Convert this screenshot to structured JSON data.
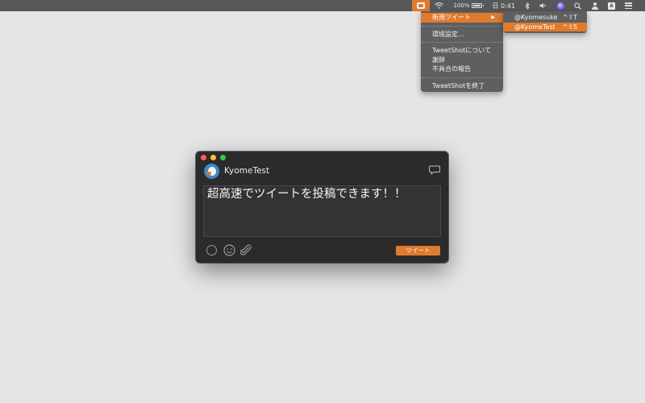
{
  "menubar": {
    "battery_percent": "100%",
    "clock": "日 0:41",
    "input_badge": "A",
    "status_icons": [
      "tweetshot-app-icon",
      "wifi-icon",
      "battery-icon",
      "bluetooth-icon",
      "volume-icon",
      "siri-icon",
      "search-icon",
      "user-icon",
      "input-source-icon",
      "notification-list-icon"
    ]
  },
  "menu": {
    "items": [
      {
        "label": "新規ツイート",
        "has_submenu": true,
        "highlighted": true
      },
      {
        "label": "環境設定..."
      },
      {
        "label": "TweetShotについて"
      },
      {
        "label": "謝辞"
      },
      {
        "label": "不具合の報告"
      },
      {
        "label": "TweetShotを終了"
      }
    ],
    "submenu": [
      {
        "label": "@Kyomesuke",
        "shortcut": "^⇧T"
      },
      {
        "label": "@KyomeTest",
        "shortcut": "^⇧S",
        "highlighted": true
      }
    ]
  },
  "window": {
    "username": "KyomeTest",
    "tweet_text": "超高速でツイートを投稿できます！！",
    "tweet_button": "ツイート",
    "accent": "#e07a2d"
  }
}
